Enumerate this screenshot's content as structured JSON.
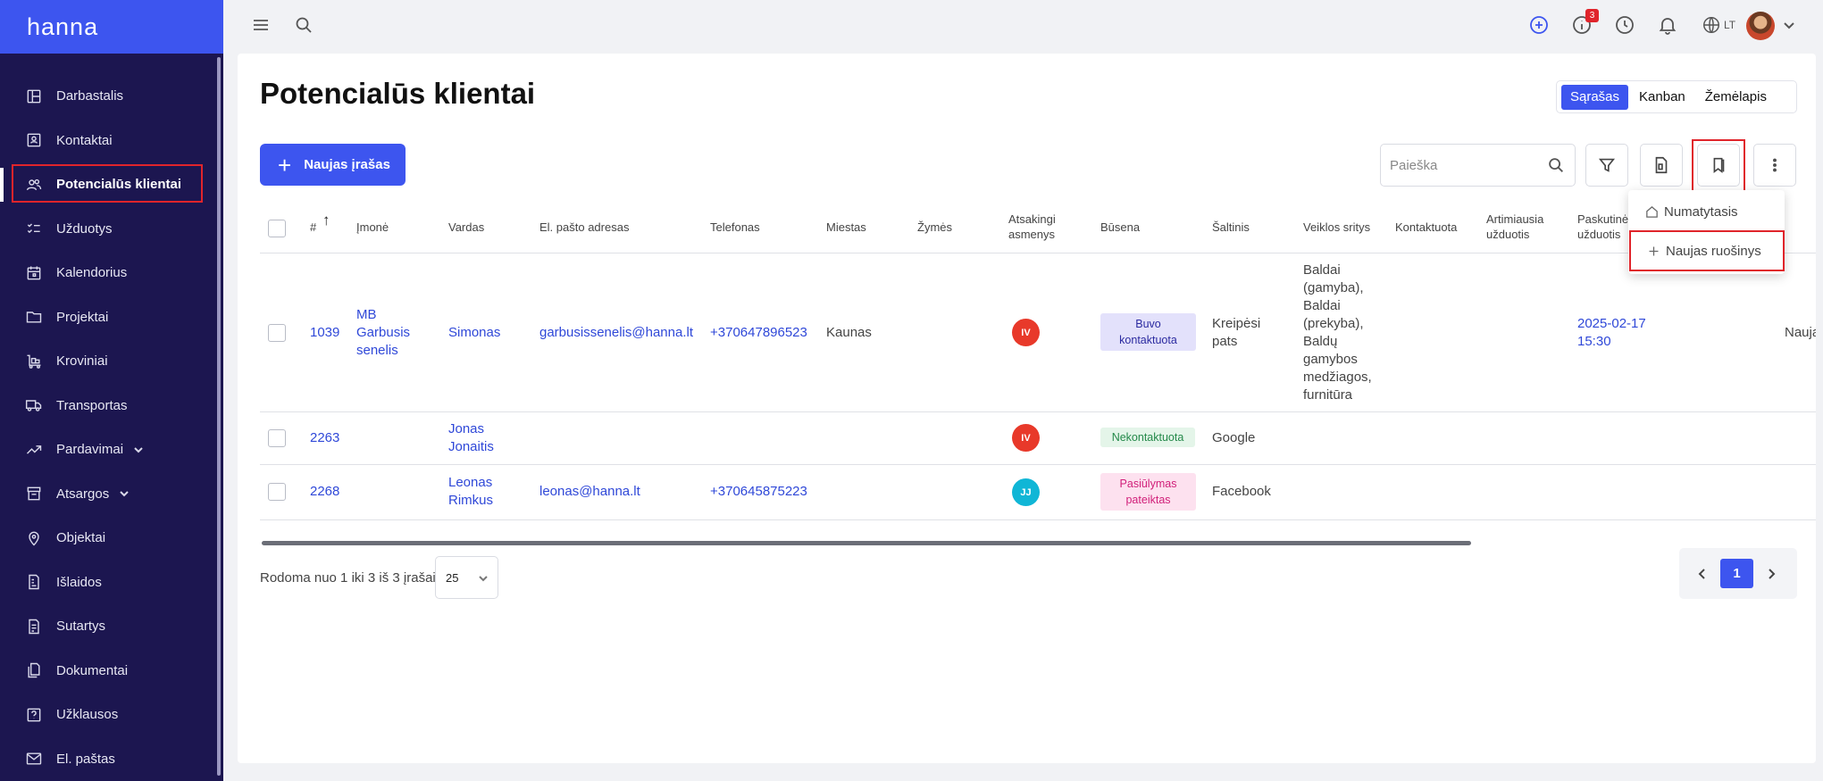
{
  "app": {
    "brand": "hanna"
  },
  "sidebar": {
    "items": [
      {
        "label": "Darbastalis",
        "icon": "dashboard-icon"
      },
      {
        "label": "Kontaktai",
        "icon": "contact-card-icon"
      },
      {
        "label": "Potencialūs klientai",
        "icon": "users-icon",
        "active": true
      },
      {
        "label": "Užduotys",
        "icon": "checklist-icon"
      },
      {
        "label": "Kalendorius",
        "icon": "calendar-icon"
      },
      {
        "label": "Projektai",
        "icon": "folder-icon"
      },
      {
        "label": "Kroviniai",
        "icon": "cargo-icon"
      },
      {
        "label": "Transportas",
        "icon": "truck-icon"
      },
      {
        "label": "Pardavimai",
        "icon": "trending-up-icon",
        "expandable": true
      },
      {
        "label": "Atsargos",
        "icon": "archive-icon",
        "expandable": true
      },
      {
        "label": "Objektai",
        "icon": "map-pin-icon"
      },
      {
        "label": "Išlaidos",
        "icon": "receipt-icon"
      },
      {
        "label": "Sutartys",
        "icon": "contract-icon"
      },
      {
        "label": "Dokumentai",
        "icon": "documents-icon"
      },
      {
        "label": "Užklausos",
        "icon": "question-icon"
      },
      {
        "label": "El. paštas",
        "icon": "mail-icon"
      }
    ]
  },
  "topbar": {
    "notification_count": "3",
    "language": "LT"
  },
  "page": {
    "title": "Potencialūs klientai",
    "views": [
      "Sąrašas",
      "Kanban",
      "Žemėlapis"
    ],
    "new_button": "Naujas įrašas",
    "search_placeholder": "Paieška",
    "dropdown": {
      "default_label": "Numatytasis",
      "new_draft_label": "Naujas ruošinys"
    }
  },
  "table": {
    "headers": {
      "num": "#",
      "company": "Įmonė",
      "name": "Vardas",
      "email": "El. pašto adresas",
      "phone": "Telefonas",
      "city": "Miestas",
      "tags": "Žymės",
      "responsible": "Atsakingi asmenys",
      "status": "Būsena",
      "source": "Šaltinis",
      "activity": "Veiklos sritys",
      "contacted": "Kontaktuota",
      "next_task": "Artimiausia užduotis",
      "last_task": "Paskutinė užduotis"
    },
    "rows": [
      {
        "num": "1039",
        "company": "MB Garbusis senelis",
        "name": "Simonas",
        "email": "garbusissenelis@hanna.lt",
        "phone": "+370647896523",
        "city": "Kaunas",
        "initials": "IV",
        "initials_color": "#e8392a",
        "status": "Buvo kontaktuota",
        "status_bg": "#e3e1fb",
        "status_fg": "#2b2aa0",
        "source": "Kreipėsi pats",
        "activity": "Baldai (gamyba), Baldai (prekyba), Baldų gamybos medžiagos, furnitūra",
        "last_task": "2025-02-17 15:30",
        "trailing": "Nauja"
      },
      {
        "num": "2263",
        "company": "",
        "name": "Jonas Jonaitis",
        "email": "",
        "phone": "",
        "city": "",
        "initials": "IV",
        "initials_color": "#e8392a",
        "status": "Nekontaktuota",
        "status_bg": "#e4f5e9",
        "status_fg": "#24894a",
        "source": "Google",
        "activity": "",
        "last_task": "",
        "trailing": ""
      },
      {
        "num": "2268",
        "company": "",
        "name": "Leonas Rimkus",
        "email": "leonas@hanna.lt",
        "phone": "+370645875223",
        "city": "",
        "initials": "JJ",
        "initials_color": "#10b6d6",
        "status": "Pasiūlymas pateiktas",
        "status_bg": "#fde1ef",
        "status_fg": "#d1207a",
        "source": "Facebook",
        "activity": "",
        "last_task": "",
        "trailing": ""
      }
    ]
  },
  "pagination": {
    "showing": "Rodoma nuo 1 iki 3 iš 3 įrašai",
    "per_page": "25",
    "current_page": "1"
  },
  "colors": {
    "primary": "#3d55ef",
    "sidebar_bg": "#1c1650",
    "highlight": "#e0242b"
  }
}
